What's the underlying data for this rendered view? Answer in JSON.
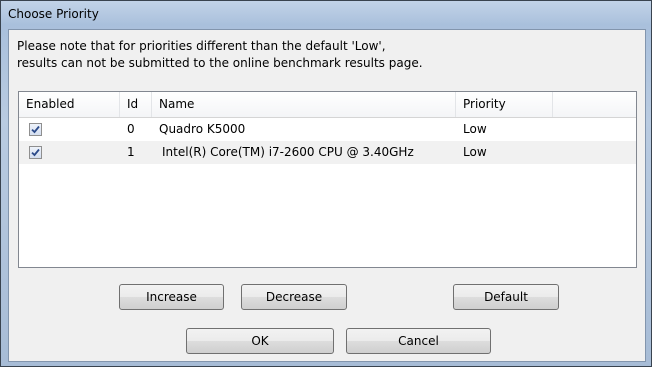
{
  "window": {
    "title": "Choose Priority"
  },
  "notice": {
    "line1": "Please note that for priorities different than the default 'Low',",
    "line2": "results can not be submitted to the online benchmark results page."
  },
  "table": {
    "columns": [
      "Enabled",
      "Id",
      "Name",
      "Priority"
    ],
    "rows": [
      {
        "enabled": true,
        "id": "0",
        "name": "Quadro K5000",
        "priority": "Low"
      },
      {
        "enabled": true,
        "id": "1",
        "name": "Intel(R) Core(TM) i7-2600 CPU @ 3.40GHz",
        "priority": "Low"
      }
    ]
  },
  "buttons": {
    "increase": "Increase",
    "decrease": "Decrease",
    "default": "Default",
    "ok": "OK",
    "cancel": "Cancel"
  },
  "icons": {
    "check": "checkmark-icon"
  }
}
